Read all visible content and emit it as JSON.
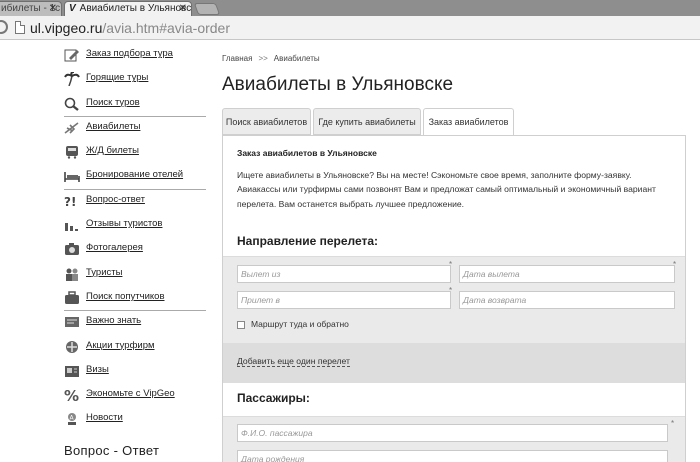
{
  "browser": {
    "tabs": [
      {
        "title": "ибилеты - 1с"
      },
      {
        "title": "Авиабилеты в Ульяновс",
        "favicon": "V"
      }
    ],
    "url_host": "ul.vipgeo.ru",
    "url_path": "/avia.htm#avia-order"
  },
  "sidebar": {
    "items": [
      {
        "label": "Заказ подбора тура",
        "icon": "pencil-icon"
      },
      {
        "label": "Горящие туры",
        "icon": "palm-tree-icon"
      },
      {
        "label": "Поиск туров",
        "icon": "magnifier-icon"
      },
      {
        "label": "Авиабилеты",
        "icon": "airplane-icon"
      },
      {
        "label": "Ж/Д билеты",
        "icon": "train-icon"
      },
      {
        "label": "Бронирование отелей",
        "icon": "bed-icon"
      },
      {
        "label": "Вопрос-ответ",
        "icon": "question-icon"
      },
      {
        "label": "Отзывы туристов",
        "icon": "review-icon"
      },
      {
        "label": "Фотогалерея",
        "icon": "camera-icon"
      },
      {
        "label": "Туристы",
        "icon": "people-icon"
      },
      {
        "label": "Поиск попутчиков",
        "icon": "suitcase-icon"
      },
      {
        "label": "Важно знать",
        "icon": "note-icon"
      },
      {
        "label": "Акции турфирм",
        "icon": "gift-icon"
      },
      {
        "label": "Визы",
        "icon": "visa-icon"
      },
      {
        "label": "Экономьте с VipGeo",
        "icon": "percent-icon"
      },
      {
        "label": "Новости",
        "icon": "news-icon"
      }
    ],
    "heading": "Вопрос - Ответ"
  },
  "main": {
    "breadcrumb": {
      "home": "Главная",
      "separator": ">>",
      "current": "Авиабилеты"
    },
    "title": "Авиабилеты в Ульяновске",
    "tabs": [
      {
        "label": "Поиск авиабилетов"
      },
      {
        "label": "Где купить авиабилеты"
      },
      {
        "label": "Заказ авиабилетов"
      }
    ],
    "intro_title": "Заказ авиабилетов в Ульяновске",
    "intro_text": "Ищете авиабилеты в Ульяновске? Вы на месте! Сэкономьте свое время, заполните форму-заявку. Авиакассы или турфирмы сами позвонят Вам и предложат самый оптимальный и экономичный вариант перелета. Вам останется выбрать лучшее предложение.",
    "section_direction": "Направление перелета:",
    "fields": {
      "from": "Вылет из",
      "depart_date": "Дата вылета",
      "to": "Прилет в",
      "return_date": "Дата возврата"
    },
    "roundtrip_label": "Маршрут туда и обратно",
    "add_flight": "Добавить еще один перелет",
    "section_passengers": "Пассажиры:",
    "passenger_fields": {
      "name": "Ф.И.О. пассажира",
      "birth": "Дата рождения"
    }
  }
}
